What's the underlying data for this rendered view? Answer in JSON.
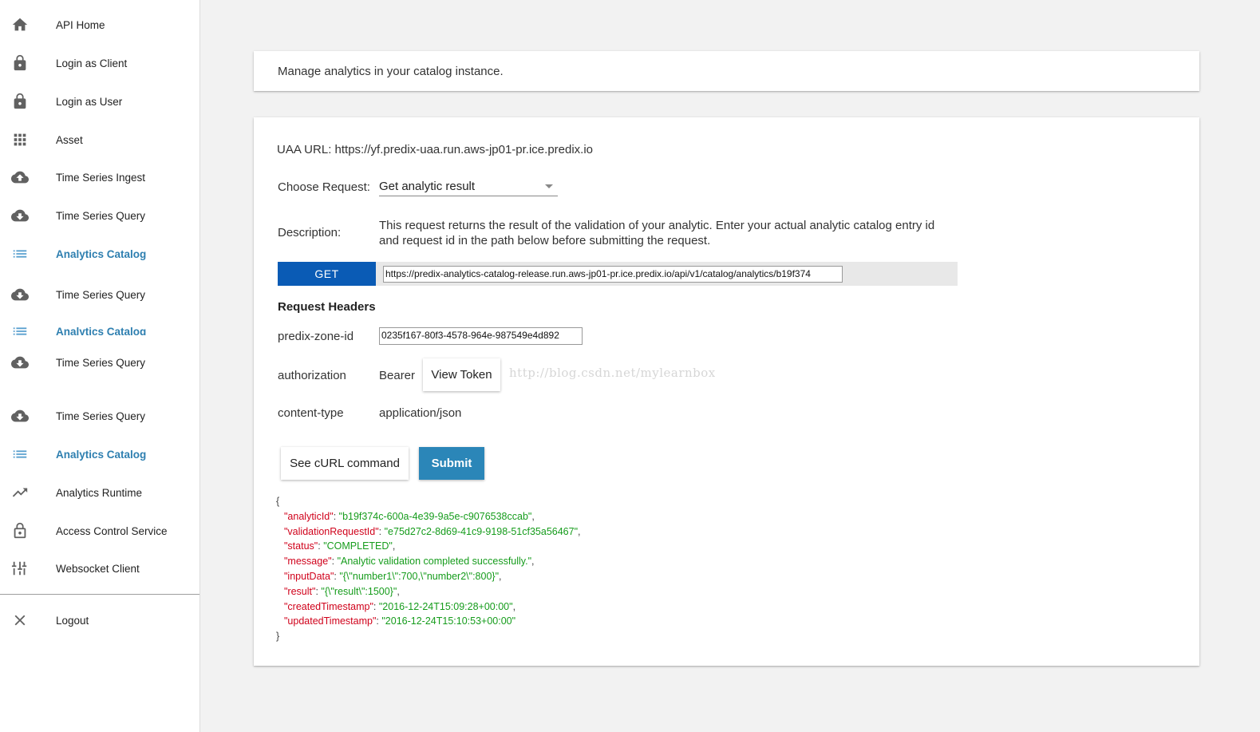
{
  "sidebar": {
    "items": [
      {
        "label": "API Home",
        "icon": "home-icon"
      },
      {
        "label": "Login as Client",
        "icon": "lock-icon"
      },
      {
        "label": "Login as User",
        "icon": "lock-icon"
      },
      {
        "label": "Asset",
        "icon": "apps-grid-icon"
      },
      {
        "label": "Time Series Ingest",
        "icon": "cloud-upload-icon"
      },
      {
        "label": "Time Series Query",
        "icon": "cloud-download-icon"
      },
      {
        "label": "Analytics Catalog",
        "icon": "list-icon",
        "active": true
      },
      {
        "label": "Time Series Query",
        "icon": "cloud-download-icon"
      },
      {
        "label": "Analytics Catalog",
        "icon": "list-icon",
        "active": true
      },
      {
        "label": "Time Series Query",
        "icon": "cloud-download-icon"
      },
      {
        "label": "Time Series Query",
        "icon": "cloud-download-icon"
      },
      {
        "label": "Analytics Catalog",
        "icon": "list-icon",
        "active": true
      },
      {
        "label": "Analytics Runtime",
        "icon": "trending-up-icon"
      },
      {
        "label": "Access Control Service",
        "icon": "lock-outline-icon"
      },
      {
        "label": "Websocket Client",
        "icon": "equalizer-icon"
      },
      {
        "label": "Logout",
        "icon": "close-icon"
      }
    ]
  },
  "intro": {
    "text": "Manage analytics in your catalog instance."
  },
  "request": {
    "uaa_url": "UAA URL: https://yf.predix-uaa.run.aws-jp01-pr.ice.predix.io",
    "choose_label": "Choose Request:",
    "choose_value": "Get analytic result",
    "description_label": "Description:",
    "description": "This request returns the result of the validation of your analytic. Enter your actual analytic catalog entry id and request id in the path below before submitting the request.",
    "method": "GET",
    "url": "https://predix-analytics-catalog-release.run.aws-jp01-pr.ice.predix.io/api/v1/catalog/analytics/b19f374",
    "headers_title": "Request Headers",
    "zone_label": "predix-zone-id",
    "zone_value": "0235f167-80f3-4578-964e-987549e4d892",
    "auth_label": "authorization",
    "auth_prefix": "Bearer",
    "view_token": "View Token",
    "content_type_label": "content-type",
    "content_type_value": "application/json",
    "curl_button": "See cURL command",
    "submit_button": "Submit"
  },
  "watermark": "http://blog.csdn.net/mylearnbox",
  "response": {
    "open": "{",
    "close": "}",
    "fields": [
      {
        "key": "\"analyticId\"",
        "value": "\"b19f374c-600a-4e39-9a5e-c9076538ccab\"",
        "comma": ","
      },
      {
        "key": "\"validationRequestId\"",
        "value": "\"e75d27c2-8d69-41c9-9198-51cf35a56467\"",
        "comma": ","
      },
      {
        "key": "\"status\"",
        "value": "\"COMPLETED\"",
        "comma": ","
      },
      {
        "key": "\"message\"",
        "value": "\"Analytic validation completed successfully.\"",
        "comma": ","
      },
      {
        "key": "\"inputData\"",
        "value": "\"{\\\"number1\\\":700,\\\"number2\\\":800}\"",
        "comma": ","
      },
      {
        "key": "\"result\"",
        "value": "\"{\\\"result\\\":1500}\"",
        "comma": ","
      },
      {
        "key": "\"createdTimestamp\"",
        "value": "\"2016-12-24T15:09:28+00:00\"",
        "comma": ","
      },
      {
        "key": "\"updatedTimestamp\"",
        "value": "\"2016-12-24T15:10:53+00:00\"",
        "comma": ""
      }
    ]
  },
  "colors": {
    "accent": "#2e7fb0",
    "get_button": "#0a5bb5",
    "submit": "#2b86b8",
    "json_key": "#d0021b",
    "json_value": "#169c1c"
  }
}
